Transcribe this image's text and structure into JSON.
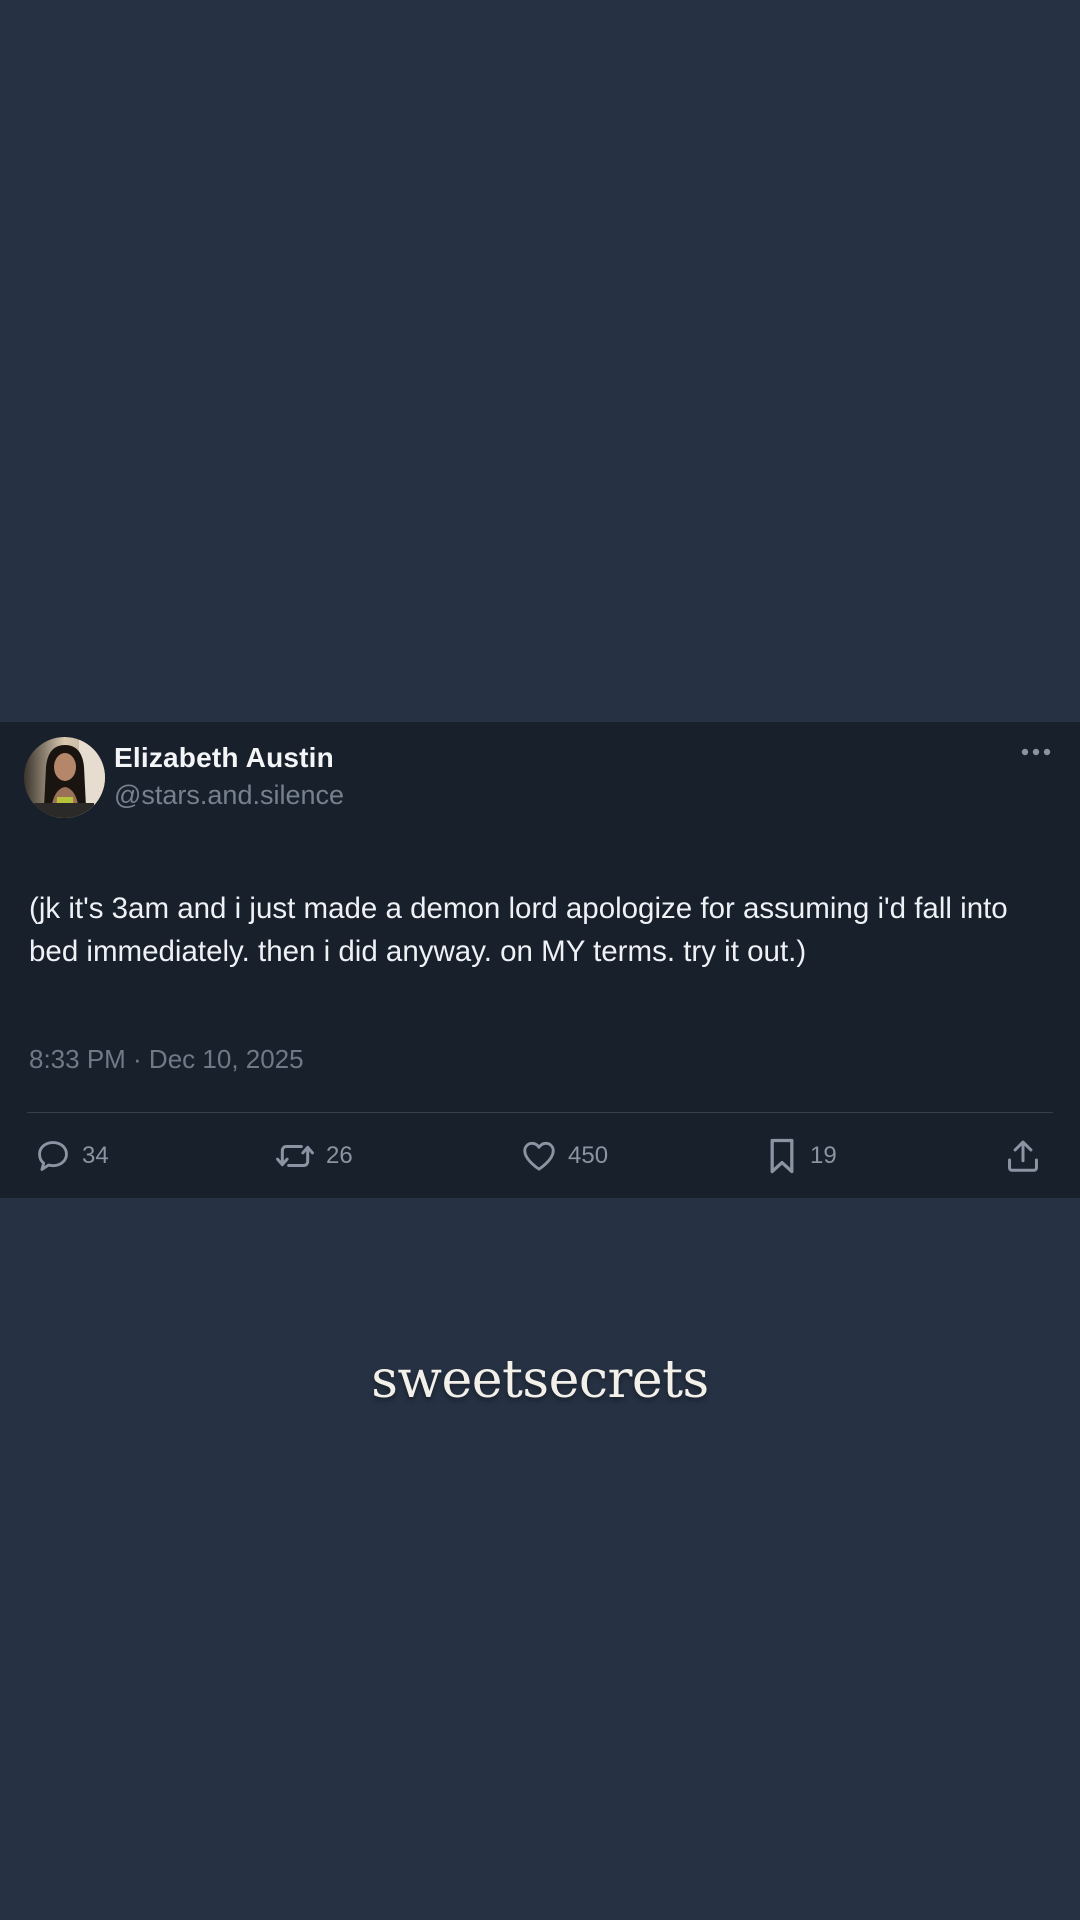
{
  "post": {
    "author": {
      "display_name": "Elizabeth Austin",
      "handle": "@stars.and.silence",
      "avatar_icon": "user-avatar"
    },
    "more_icon": "more-options-icon",
    "text": "(jk it's 3am and i just made a demon lord apologize for assuming i'd fall into bed immediately. then i did anyway. on MY terms. try it out.)",
    "timestamp": "8:33 PM · Dec 10, 2025",
    "actions": {
      "reply": {
        "icon": "reply-icon",
        "count": "34"
      },
      "repost": {
        "icon": "repost-icon",
        "count": "26"
      },
      "like": {
        "icon": "heart-icon",
        "count": "450"
      },
      "bookmark": {
        "icon": "bookmark-icon",
        "count": "19"
      },
      "share": {
        "icon": "share-icon"
      }
    }
  },
  "brand": {
    "name": "sweetsecrets"
  },
  "colors": {
    "page_background": "#263244",
    "card_background": "#18202b",
    "primary_text": "#eef1f5",
    "secondary_text": "#76818f",
    "icon": "#8a94a2"
  }
}
